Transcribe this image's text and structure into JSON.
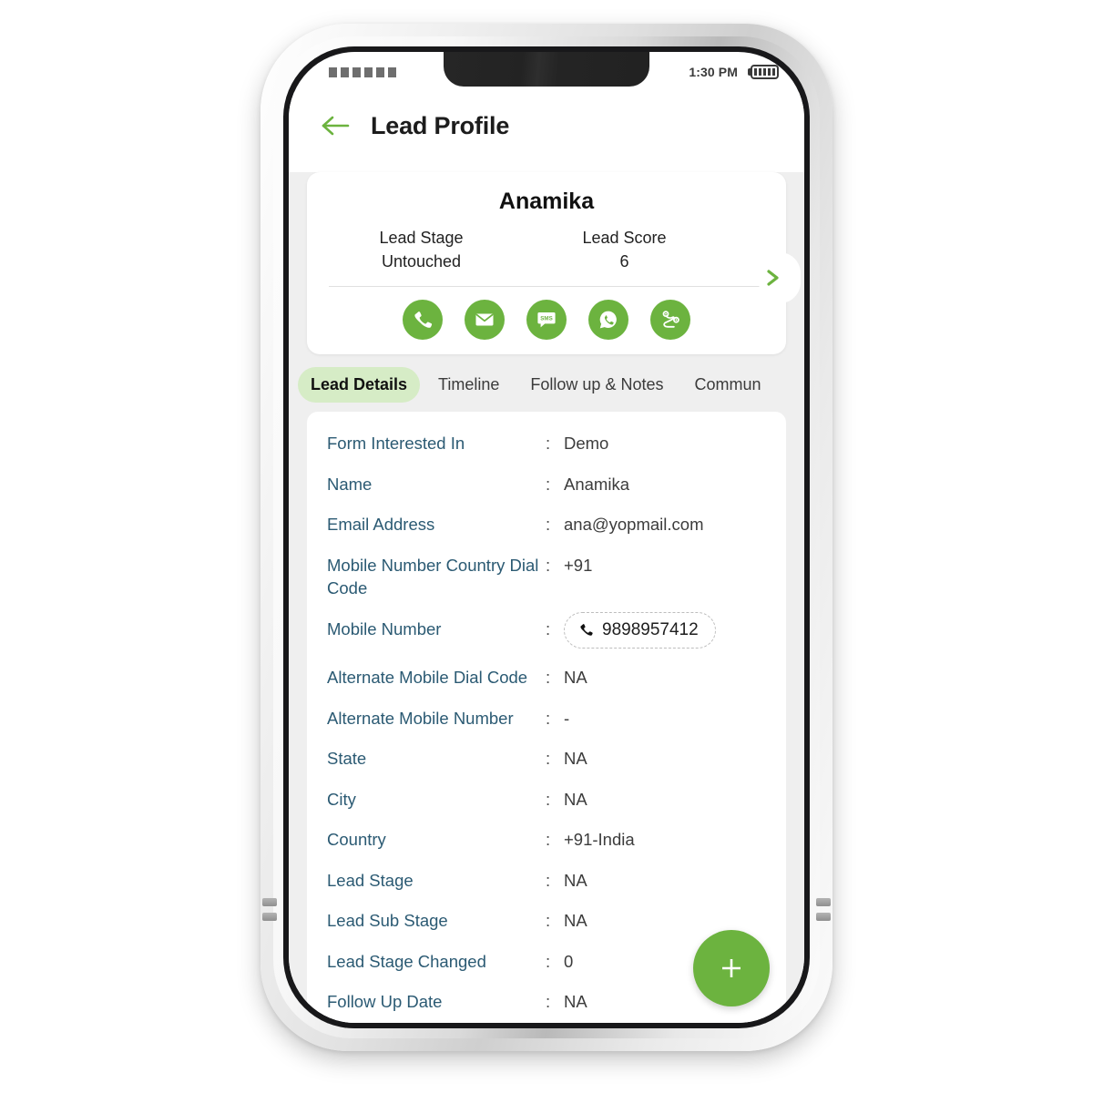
{
  "device": {
    "status_bar": {
      "signal_bars": 6,
      "time": "1:30 PM",
      "battery_level_bars": 5
    }
  },
  "appbar": {
    "back_icon": "arrow-left-icon",
    "title": "Lead Profile"
  },
  "profile_card": {
    "name": "Anamika",
    "stats": [
      {
        "label": "Lead Stage",
        "value": "Untouched"
      },
      {
        "label": "Lead Score",
        "value": "6"
      }
    ],
    "expand_icon": "chevron-right-icon",
    "actions": [
      {
        "name": "call-action",
        "icon": "phone-icon",
        "label": "Call"
      },
      {
        "name": "email-action",
        "icon": "envelope-icon",
        "label": "Email"
      },
      {
        "name": "sms-action",
        "icon": "sms-bubble-icon",
        "label": "SMS"
      },
      {
        "name": "whatsapp-action",
        "icon": "whatsapp-icon",
        "label": "WhatsApp"
      },
      {
        "name": "route-action",
        "icon": "route-pin-icon",
        "label": "Route"
      }
    ]
  },
  "tabs": [
    {
      "label": "Lead Details",
      "active": true
    },
    {
      "label": "Timeline",
      "active": false
    },
    {
      "label": "Follow up & Notes",
      "active": false
    },
    {
      "label": "Commun",
      "active": false
    }
  ],
  "details": {
    "rows": [
      {
        "label": "Form Interested In",
        "sep": ":",
        "value": "Demo",
        "type": "text"
      },
      {
        "label": "Name",
        "sep": ":",
        "value": "Anamika",
        "type": "text"
      },
      {
        "label": "Email Address",
        "sep": ":",
        "value": "ana@yopmail.com",
        "type": "text"
      },
      {
        "label": "Mobile Number Country Dial Code",
        "sep": ":",
        "value": "+91",
        "type": "text"
      },
      {
        "label": "Mobile Number",
        "sep": ":",
        "value": "9898957412",
        "type": "phone-chip"
      },
      {
        "label": "Alternate Mobile Dial Code",
        "sep": ":",
        "value": "NA",
        "type": "text"
      },
      {
        "label": "Alternate Mobile Number",
        "sep": ":",
        "value": "-",
        "type": "text"
      },
      {
        "label": "State",
        "sep": ":",
        "value": "NA",
        "type": "text"
      },
      {
        "label": "City",
        "sep": ":",
        "value": "NA",
        "type": "text"
      },
      {
        "label": "Country",
        "sep": ":",
        "value": "+91-India",
        "type": "text"
      },
      {
        "label": "Lead Stage",
        "sep": ":",
        "value": "NA",
        "type": "text"
      },
      {
        "label": "Lead Sub Stage",
        "sep": ":",
        "value": "NA",
        "type": "text"
      },
      {
        "label": "Lead Stage Changed",
        "sep": ":",
        "value": "0",
        "type": "text"
      },
      {
        "label": "Follow Up Date",
        "sep": ":",
        "value": "NA",
        "type": "text"
      }
    ]
  },
  "fab": {
    "icon": "plus-icon",
    "label": "+"
  },
  "colors": {
    "brand_green": "#6cb33f",
    "tab_active_bg": "#d6ecc6",
    "label_blue": "#2b5a73",
    "app_bg": "#efefef"
  }
}
